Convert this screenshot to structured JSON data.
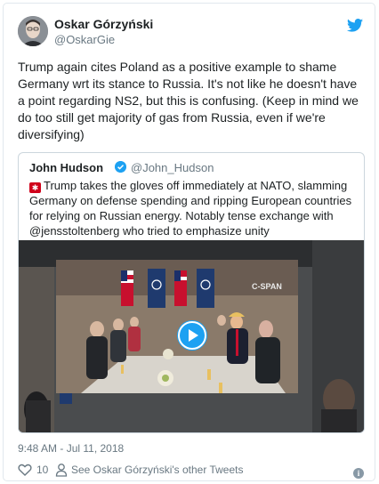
{
  "tweet": {
    "author_name": "Oskar Górzyński",
    "author_handle": "@OskarGie",
    "text": "Trump again cites Poland as a positive example to shame Germany wrt its stance to Russia. It's not like he doesn't have a point regarding NS2, but this is confusing. (Keep in mind we do too still get majority of gas from Russia, even if we're diversifying)",
    "timestamp": "9:48 AM - Jul 11, 2018",
    "likes": "10",
    "see_more": "See Oskar Górzyński's other Tweets",
    "info_glyph": "i"
  },
  "quoted": {
    "author_name": "John Hudson",
    "author_handle": "@John_Hudson",
    "emoji_glyph": "✱",
    "text": "Trump takes the gloves off immediately at NATO, slamming Germany on defense spending and ripping European countries for relying on Russian energy. Notably tense exchange with @jensstoltenberg who tried to emphasize unity",
    "video_watermark": "C-SPAN"
  },
  "colors": {
    "accent": "#1da1f2",
    "muted": "#697882",
    "flag_red": "#c8102e",
    "nato_blue": "#1f3a6e"
  },
  "icons": [
    "twitter-bird-icon",
    "verified-badge-icon",
    "alert-emoji-icon",
    "play-icon",
    "heart-icon",
    "person-icon",
    "info-icon"
  ]
}
